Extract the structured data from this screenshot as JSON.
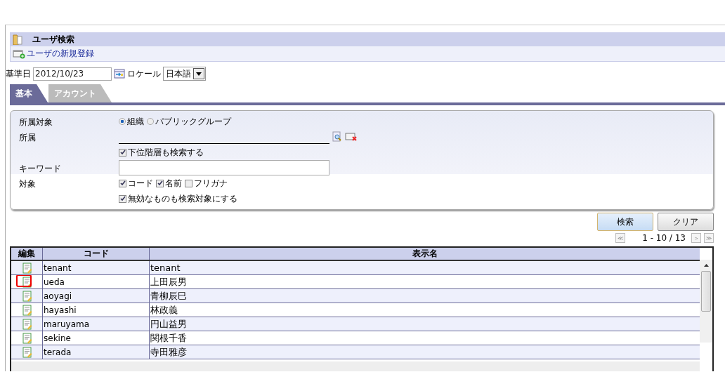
{
  "page": {
    "title": "ユーザ検索",
    "new_link": "ユーザの新規登録"
  },
  "date_row": {
    "label": "基準日",
    "value": "2012/10/23",
    "locale_label": "ロケール",
    "locale_value": "日本語"
  },
  "tabs": [
    {
      "label": "基本",
      "selected": true
    },
    {
      "label": "アカウント",
      "selected": false
    }
  ],
  "form": {
    "affiliation_type": {
      "label": "所属対象",
      "options": [
        {
          "label": "組織",
          "selected": true
        },
        {
          "label": "パブリックグループ",
          "selected": false
        }
      ]
    },
    "affiliation": {
      "label": "所属"
    },
    "include_sub": {
      "label": "下位階層も検索する",
      "checked": true
    },
    "keyword": {
      "label": "キーワード"
    },
    "target": {
      "label": "対象",
      "options": [
        {
          "label": "コード",
          "checked": true
        },
        {
          "label": "名前",
          "checked": true
        },
        {
          "label": "フリガナ",
          "checked": false
        }
      ]
    },
    "include_invalid": {
      "label": "無効なものも検索対象にする",
      "checked": true
    }
  },
  "buttons": [
    {
      "label": "検索",
      "kind": "primary"
    },
    {
      "label": "クリア",
      "kind": "normal"
    }
  ],
  "pager": {
    "text": "1 - 10 / 13",
    "first": "≪",
    "next": ">",
    "last": "≫"
  },
  "table": {
    "columns": [
      "編集",
      "コード",
      "表示名"
    ],
    "rows": [
      {
        "code": "tenant",
        "name": "tenant",
        "highlighted": false
      },
      {
        "code": "ueda",
        "name": "上田辰男",
        "highlighted": true
      },
      {
        "code": "aoyagi",
        "name": "青柳辰巳",
        "highlighted": false
      },
      {
        "code": "hayashi",
        "name": "林政義",
        "highlighted": false
      },
      {
        "code": "maruyama",
        "name": "円山益男",
        "highlighted": false
      },
      {
        "code": "sekine",
        "name": "関根千香",
        "highlighted": false
      },
      {
        "code": "terada",
        "name": "寺田雅彦",
        "highlighted": false
      }
    ]
  }
}
